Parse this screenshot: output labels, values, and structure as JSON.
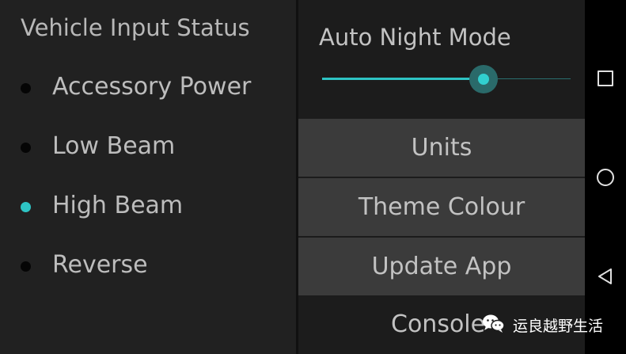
{
  "left_panel": {
    "title": "Vehicle Input Status",
    "inputs": [
      {
        "label": "Accessory Power",
        "active": false
      },
      {
        "label": "Low Beam",
        "active": false
      },
      {
        "label": "High Beam",
        "active": true
      },
      {
        "label": "Reverse",
        "active": false
      }
    ]
  },
  "right_panel": {
    "night_mode_title": "Auto Night Mode",
    "night_mode_level": 0.65,
    "buttons": {
      "units": "Units",
      "theme": "Theme Colour",
      "update": "Update App"
    },
    "console_label": "Console"
  },
  "nav_bar": {
    "icons": [
      "recents-square-icon",
      "home-circle-icon",
      "back-triangle-icon"
    ]
  },
  "watermark": {
    "text": "运良越野生活",
    "icon": "wechat-icon"
  },
  "colors": {
    "accent": "#2ec4c4",
    "inactive_dot": "#050505",
    "button_bg": "#3b3b3b",
    "nav_bg": "#000000"
  }
}
